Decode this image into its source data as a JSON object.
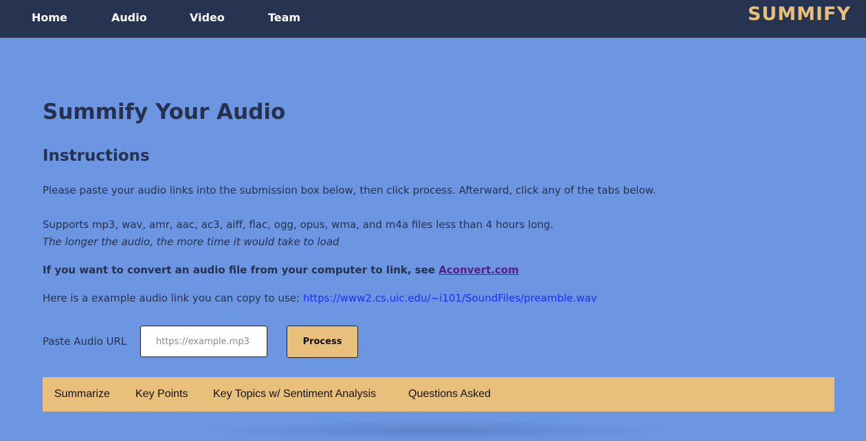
{
  "nav": {
    "links": [
      "Home",
      "Audio",
      "Video",
      "Team"
    ],
    "brand": "SUMMIFY"
  },
  "main": {
    "title": "Summify Your Audio",
    "instructions_heading": "Instructions",
    "instructions_text": "Please paste your audio links into the submission box below, then click process. Afterward, click any of the tabs below.",
    "supports_text": "Supports mp3, wav, amr, aac, ac3, aiff, flac, ogg, opus, wma, and m4a files less than 4 hours long.",
    "longer_note": "The longer the audio, the more time it would take to load",
    "convert_text": "If you want to convert an audio file from your computer to link, see ",
    "convert_link": "Aconvert.com",
    "example_text": "Here is a example audio link you can copy to use: ",
    "example_link": "https://www2.cs.uic.edu/~i101/SoundFiles/preamble.wav"
  },
  "form": {
    "label": "Paste Audio URL",
    "placeholder": "https://example.mp3",
    "value": "",
    "button": "Process"
  },
  "tabs": [
    "Summarize",
    "Key Points",
    "Key Topics w/ Sentiment Analysis",
    "Questions Asked"
  ],
  "colors": {
    "navbar": "#263451",
    "background": "#6c96e2",
    "accent": "#e8c07b",
    "text": "#25314e",
    "link": "#1f2bff",
    "visited_link": "#5a1d86"
  }
}
